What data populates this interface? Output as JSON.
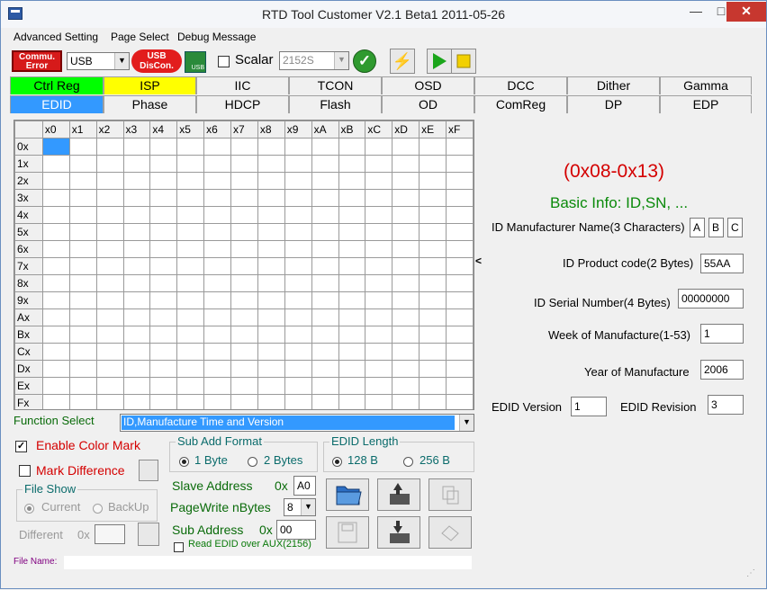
{
  "window": {
    "title": "RTD Tool Customer V2.1 Beta1    2011-05-26",
    "min_glyph": "—",
    "max_glyph": "□",
    "close_glyph": "✕"
  },
  "menu": [
    "Advanced Setting",
    "Page Select",
    "Debug Message"
  ],
  "toolbar": {
    "error_label": "Commu. Error",
    "interface_value": "USB",
    "usb_disconnect_label": "USB DisCon.",
    "usb_icon_text": "USB",
    "scalar_label": "Scalar",
    "scalar_value": "2152S"
  },
  "tabs_row1": [
    {
      "label": "Ctrl Reg",
      "color": "#00ff00"
    },
    {
      "label": "ISP",
      "color": "#ffff00"
    },
    {
      "label": "IIC",
      "color": ""
    },
    {
      "label": "TCON",
      "color": ""
    },
    {
      "label": "OSD",
      "color": ""
    },
    {
      "label": "DCC",
      "color": ""
    },
    {
      "label": "Dither",
      "color": ""
    },
    {
      "label": "Gamma",
      "color": ""
    }
  ],
  "tabs_row2": [
    {
      "label": "EDID",
      "color": "#3399ff",
      "active": true
    },
    {
      "label": "Phase",
      "color": ""
    },
    {
      "label": "HDCP",
      "color": ""
    },
    {
      "label": "Flash",
      "color": ""
    },
    {
      "label": "OD",
      "color": ""
    },
    {
      "label": "ComReg",
      "color": ""
    },
    {
      "label": "DP",
      "color": ""
    },
    {
      "label": "EDP",
      "color": ""
    }
  ],
  "grid": {
    "col_headers": [
      "x0",
      "x1",
      "x2",
      "x3",
      "x4",
      "x5",
      "x6",
      "x7",
      "x8",
      "x9",
      "xA",
      "xB",
      "xC",
      "xD",
      "xE",
      "xF"
    ],
    "row_headers": [
      "0x",
      "1x",
      "2x",
      "3x",
      "4x",
      "5x",
      "6x",
      "7x",
      "8x",
      "9x",
      "Ax",
      "Bx",
      "Cx",
      "Dx",
      "Ex",
      "Fx"
    ]
  },
  "splitter_glyph": "<",
  "info": {
    "range": "(0x08-0x13)",
    "basic_info": "Basic Info: ID,SN, ...",
    "manufacturer_label": "ID Manufacturer Name(3 Characters)",
    "manufacturer_chars": [
      "A",
      "B",
      "C"
    ],
    "product_label": "ID Product code(2 Bytes)",
    "product_value": "55AA",
    "serial_label": "ID Serial Number(4 Bytes)",
    "serial_value": "00000000",
    "week_label": "Week of Manufacture(1-53)",
    "week_value": "1",
    "year_label": "Year of Manufacture",
    "year_value": "2006",
    "version_label": "EDID Version",
    "version_value": "1",
    "revision_label": "EDID Revision",
    "revision_value": "3"
  },
  "function_select": {
    "label": "Function Select",
    "value": "ID,Manufacture Time and Version"
  },
  "options": {
    "enable_color_mark": "Enable Color Mark",
    "mark_difference": "Mark Difference",
    "file_show_title": "File Show",
    "current": "Current",
    "backup": "BackUp",
    "different_label": "Different",
    "different_prefix": "0x"
  },
  "sub_add_format": {
    "title": "Sub Add Format",
    "byte1": "1 Byte",
    "byte2": "2 Bytes"
  },
  "edid_length": {
    "title": "EDID Length",
    "b128": "128 B",
    "b256": "256 B"
  },
  "address": {
    "slave_label": "Slave Address",
    "slave_prefix": "0x",
    "slave_value": "A0",
    "pagewrite_label": "PageWrite nBytes",
    "pagewrite_value": "8",
    "sub_label": "Sub Address",
    "sub_prefix": "0x",
    "sub_value": "00",
    "read_aux_label": "Read EDID over AUX(2156)"
  },
  "status": {
    "file_name_label": "File Name:"
  }
}
